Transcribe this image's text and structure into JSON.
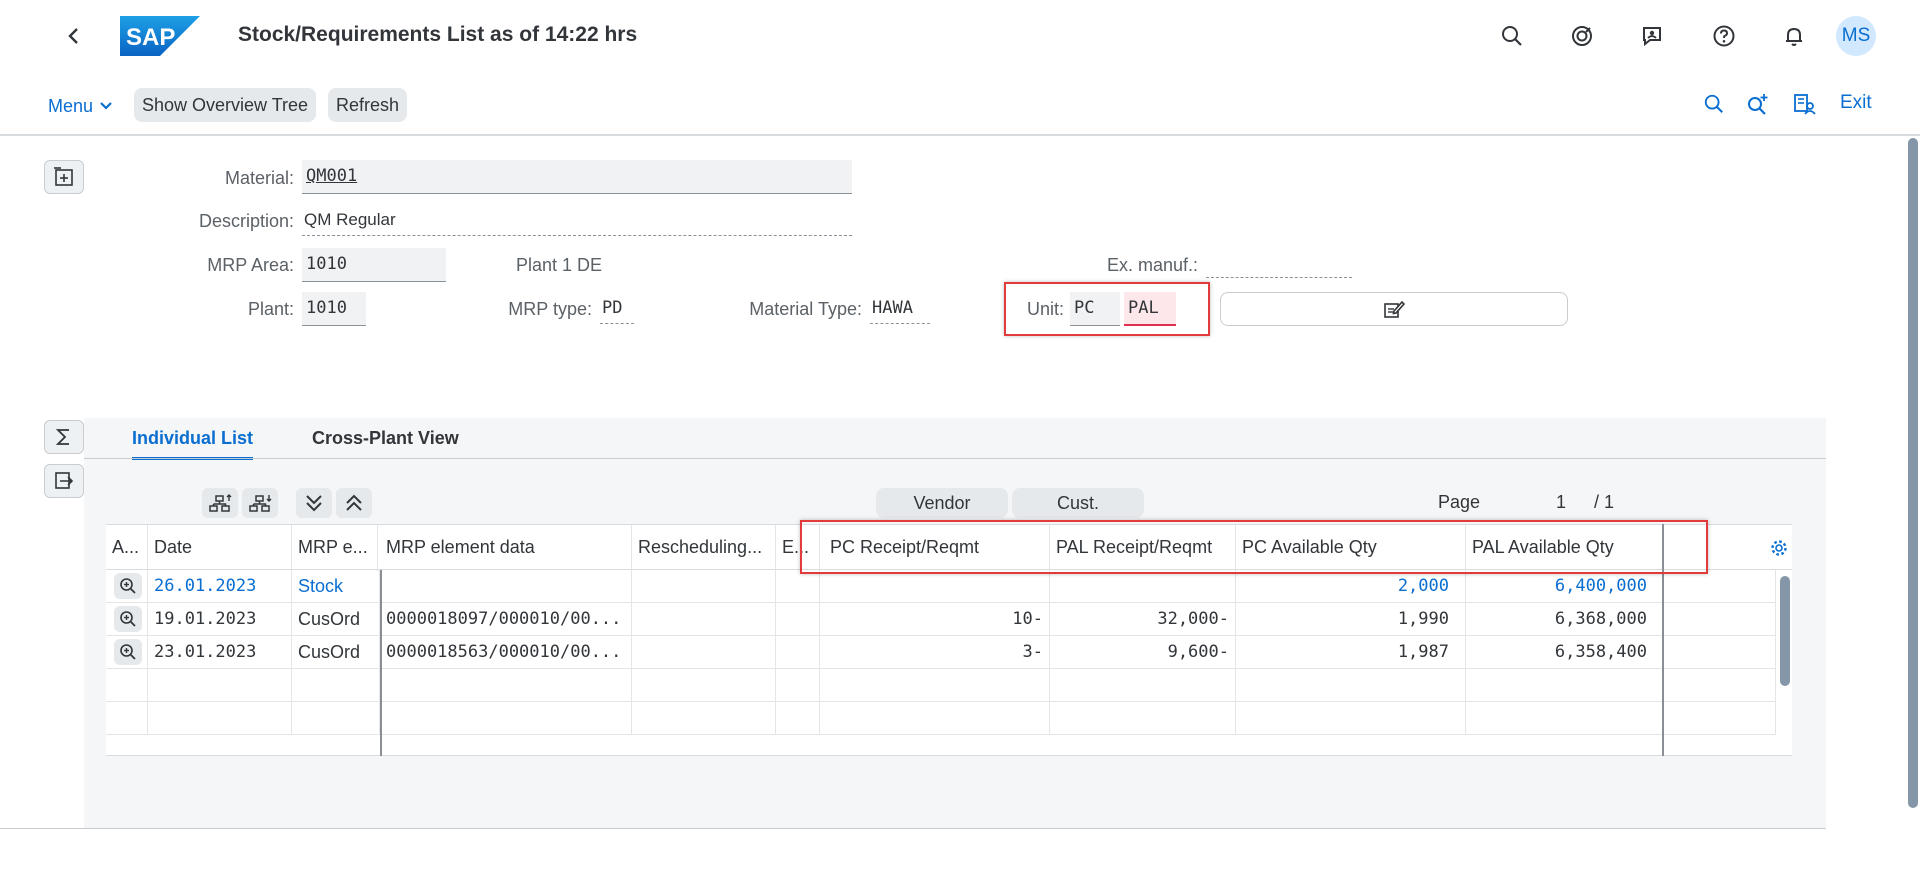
{
  "shell": {
    "title": "Stock/Requirements List as of 14:22 hrs",
    "logo_text": "SAP",
    "avatar": "MS",
    "icons": [
      "search-icon",
      "copilot-icon",
      "feedback-icon",
      "help-icon",
      "notifications-icon"
    ]
  },
  "toolbar": {
    "menu_label": "Menu",
    "show_overview_tree": "Show Overview Tree",
    "refresh": "Refresh",
    "exit": "Exit"
  },
  "header": {
    "material_label": "Material:",
    "material_value": "QM001",
    "description_label": "Description:",
    "description_value": "QM Regular",
    "mrp_area_label": "MRP Area:",
    "mrp_area_value": "1010",
    "mrp_area_text": "Plant 1 DE",
    "ex_manuf_label": "Ex. manuf.:",
    "ex_manuf_value": "",
    "plant_label": "Plant:",
    "plant_value": "1010",
    "mrp_type_label": "MRP type:",
    "mrp_type_value": "PD",
    "material_type_label": "Material Type:",
    "material_type_value": "HAWA",
    "unit_label": "Unit:",
    "unit_value_1": "PC",
    "unit_value_2": "PAL"
  },
  "tabs": [
    {
      "label": "Individual List",
      "active": true
    },
    {
      "label": "Cross-Plant View",
      "active": false
    }
  ],
  "grid_toolbar": {
    "vendor": "Vendor",
    "cust": "Cust.",
    "page_label": "Page",
    "page_current": "1",
    "page_total": "/ 1"
  },
  "table": {
    "columns": [
      "A...",
      "Date",
      "MRP e...",
      "MRP element data",
      "Rescheduling...",
      "E...",
      "PC Receipt/Reqmt",
      "PAL Receipt/Reqmt",
      "PC Available Qty",
      "PAL Available Qty"
    ],
    "rows": [
      {
        "date": "26.01.2023",
        "mrp_element": "Stock",
        "element_data": "",
        "rescheduling": "",
        "e": "",
        "pc_receipt": "",
        "pal_receipt": "",
        "pc_avail": "2,000",
        "pal_avail": "6,400,000",
        "link": true
      },
      {
        "date": "19.01.2023",
        "mrp_element": "CusOrd",
        "element_data": "0000018097/000010/00...",
        "rescheduling": "",
        "e": "",
        "pc_receipt": "10-",
        "pal_receipt": "32,000-",
        "pc_avail": "1,990",
        "pal_avail": "6,368,000",
        "link": false
      },
      {
        "date": "23.01.2023",
        "mrp_element": "CusOrd",
        "element_data": "0000018563/000010/00...",
        "rescheduling": "",
        "e": "",
        "pc_receipt": "3-",
        "pal_receipt": "9,600-",
        "pc_avail": "1,987",
        "pal_avail": "6,358,400",
        "link": false
      }
    ]
  },
  "colors": {
    "accent": "#0a6ed1",
    "highlight": "#e23b3b",
    "unit_pal_bg": "#fde7ea"
  }
}
